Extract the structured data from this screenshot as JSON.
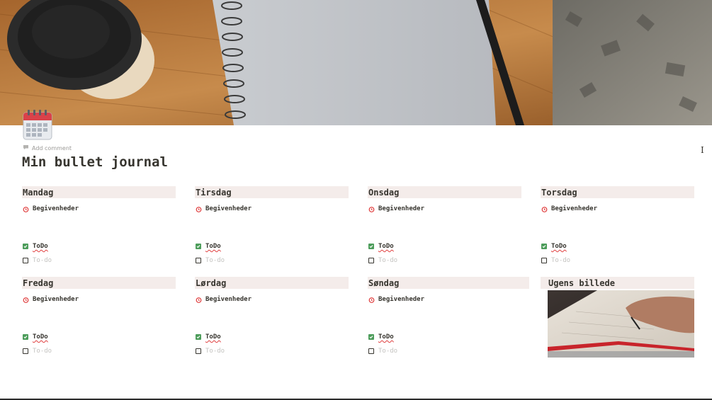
{
  "page": {
    "title": "Min bullet journal",
    "add_comment": "Add comment",
    "cover_icon": "notebook-coffee-cover-image",
    "page_icon": "calendar-icon"
  },
  "days": [
    {
      "title": "Mandag",
      "event_label": "Begivenheder",
      "todo_checked": "ToDo",
      "todo_placeholder": "To-do"
    },
    {
      "title": "Tirsdag",
      "event_label": "Begivenheder",
      "todo_checked": "ToDo",
      "todo_placeholder": "To-do"
    },
    {
      "title": "Onsdag",
      "event_label": "Begivenheder",
      "todo_checked": "ToDo",
      "todo_placeholder": "To-do"
    },
    {
      "title": "Torsdag",
      "event_label": "Begivenheder",
      "todo_checked": "ToDo",
      "todo_placeholder": "To-do"
    },
    {
      "title": "Fredag",
      "event_label": "Begivenheder",
      "todo_checked": "ToDo",
      "todo_placeholder": "To-do"
    },
    {
      "title": "Lørdag",
      "event_label": "Begivenheder",
      "todo_checked": "ToDo",
      "todo_placeholder": "To-do"
    },
    {
      "title": "Søndag",
      "event_label": "Begivenheder",
      "todo_checked": "ToDo",
      "todo_placeholder": "To-do"
    }
  ],
  "week_photo": {
    "title": "Ugens billede",
    "image": "hand-writing-in-notebook-photo"
  },
  "colors": {
    "heading_bg": "#f4ecea",
    "check_green": "#4d9d5b",
    "alarm_red": "#e03e3e",
    "text": "#37352f",
    "muted": "#9b9a97"
  }
}
